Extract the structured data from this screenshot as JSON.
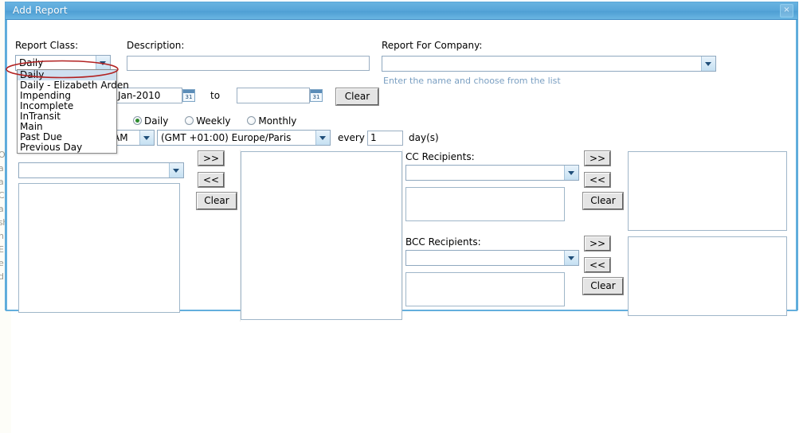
{
  "window": {
    "title": "Add Report",
    "close_label": "×"
  },
  "background_page": {
    "edge_text": "O\na\na\nC\na\nsh\nn\nE\ne\nd"
  },
  "form": {
    "report_class": {
      "label": "Report Class:",
      "value": "Daily",
      "options": [
        "Daily",
        "Daily - Elizabeth Arden",
        "Impending",
        "Incomplete",
        "InTransit",
        "Main",
        "Past Due",
        "Previous Day"
      ],
      "highlighted_option": "Daily",
      "annotated_option": "Daily - Elizabeth Arden",
      "annotation_color": "#b22222"
    },
    "description": {
      "label": "Description:",
      "value": "",
      "placeholder": ""
    },
    "report_for_company": {
      "label": "Report For Company:",
      "value": "",
      "placeholder": "",
      "hint": "Enter the name and choose from the list"
    },
    "date_range": {
      "from_value": "-Jan-2010",
      "to_label": "to",
      "to_value": "",
      "clear_label": "Clear",
      "calendar_icon_day": "31"
    },
    "frequency": {
      "options": [
        "Daily",
        "Weekly",
        "Monthly"
      ],
      "selected": "Daily"
    },
    "schedule": {
      "time_value": "AM",
      "timezone_value": "(GMT +01:00) Europe/Paris",
      "every_label": "every",
      "interval_value": "1",
      "unit_label": "day(s)"
    },
    "to_recipients": {
      "combo_value": "",
      "selection_value": "",
      "add_label": ">>",
      "remove_label": "<<",
      "clear_label": "Clear"
    },
    "cc_recipients": {
      "label": "CC Recipients:",
      "combo_value": "",
      "selection_value": "",
      "add_label": ">>",
      "remove_label": "<<",
      "clear_label": "Clear"
    },
    "bcc_recipients": {
      "label": "BCC Recipients:",
      "combo_value": "",
      "selection_value": "",
      "add_label": ">>",
      "remove_label": "<<",
      "clear_label": "Clear"
    }
  },
  "theme": {
    "title_bar": "#59a7da",
    "border": "#63afdd",
    "hint_text": "#7a9fc2",
    "radio_dot": "#2e8b2e"
  }
}
